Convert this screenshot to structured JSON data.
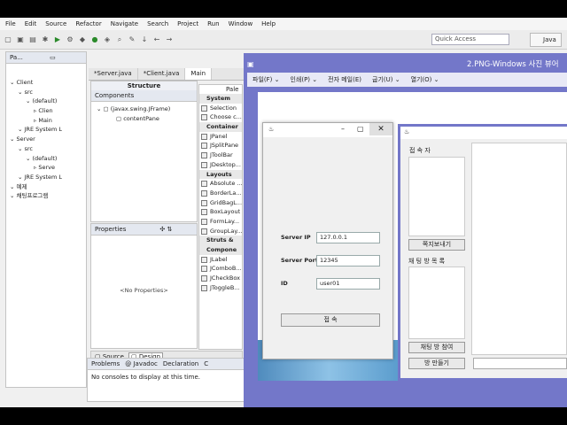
{
  "eclipse": {
    "menu": [
      "File",
      "Edit",
      "Source",
      "Refactor",
      "Navigate",
      "Search",
      "Project",
      "Run",
      "Window",
      "Help"
    ],
    "quick_access": "Quick Access",
    "perspective": "Java",
    "explorer_tab": "Pa...",
    "tree": [
      {
        "label": "Client",
        "indent": 0
      },
      {
        "label": "src",
        "indent": 1
      },
      {
        "label": "(default)",
        "indent": 2
      },
      {
        "label": "Clien",
        "indent": 3
      },
      {
        "label": "Main",
        "indent": 3
      },
      {
        "label": "JRE System L",
        "indent": 1
      },
      {
        "label": "Server",
        "indent": 0
      },
      {
        "label": "src",
        "indent": 1
      },
      {
        "label": "(default)",
        "indent": 2
      },
      {
        "label": "Serve",
        "indent": 3
      },
      {
        "label": "JRE System L",
        "indent": 1
      },
      {
        "label": "예제",
        "indent": 0
      },
      {
        "label": "채팅프로그램",
        "indent": 0
      }
    ],
    "editor_tabs": [
      "*Server.java",
      "*Client.java",
      "Main"
    ],
    "structure_title": "Structure",
    "components_tab": "Components",
    "components": [
      "(javax.swing.JFrame)",
      "contentPane"
    ],
    "properties_tab": "Properties",
    "no_properties": "<No Properties>",
    "palette_title": "Pale",
    "palette": [
      {
        "label": "System",
        "cat": true
      },
      {
        "label": "Selection",
        "cat": false
      },
      {
        "label": "Choose c...",
        "cat": false
      },
      {
        "label": "Container",
        "cat": true
      },
      {
        "label": "JPanel",
        "cat": false
      },
      {
        "label": "JSplitPane",
        "cat": false
      },
      {
        "label": "JToolBar",
        "cat": false
      },
      {
        "label": "JDesktop...",
        "cat": false
      },
      {
        "label": "Layouts",
        "cat": true
      },
      {
        "label": "Absolute ...",
        "cat": false
      },
      {
        "label": "BorderLa...",
        "cat": false
      },
      {
        "label": "GridBagL...",
        "cat": false
      },
      {
        "label": "BoxLayout",
        "cat": false
      },
      {
        "label": "FormLay...",
        "cat": false
      },
      {
        "label": "GroupLay...",
        "cat": false
      },
      {
        "label": "Struts &",
        "cat": true
      },
      {
        "label": "Compone",
        "cat": true
      },
      {
        "label": "JLabel",
        "cat": false
      },
      {
        "label": "JComboB...",
        "cat": false
      },
      {
        "label": "JCheckBox",
        "cat": false
      },
      {
        "label": "JToggleB...",
        "cat": false
      }
    ],
    "source_tab": "Source",
    "design_tab": "Design",
    "bottom_tabs": [
      "Problems",
      "@ Javadoc",
      "Declaration",
      "C"
    ],
    "console_text": "No consoles to display at this time."
  },
  "viewer": {
    "title": "2.PNG-Windows 사진 뷰어",
    "menu": [
      "파일(F) ⌄",
      "인쇄(P) ⌄",
      "전자 메일(E)",
      "굽기(U) ⌄",
      "열기(O) ⌄"
    ]
  },
  "login": {
    "ip_label": "Server IP",
    "ip_value": "127.0.0.1",
    "port_label": "Server Port",
    "port_value": "12345",
    "id_label": "ID",
    "id_value": "user01",
    "connect_label": "접 속"
  },
  "chat": {
    "users_label": "접 속 자",
    "send_button": "쪽지보내기",
    "rooms_label": "채 팅 방 목 록",
    "join_button": "채팅 방 참여",
    "create_button": "방 만들기"
  },
  "colors": {
    "viewer_frame": "#7377c9",
    "viewer_menu": "#e8e9f6"
  }
}
